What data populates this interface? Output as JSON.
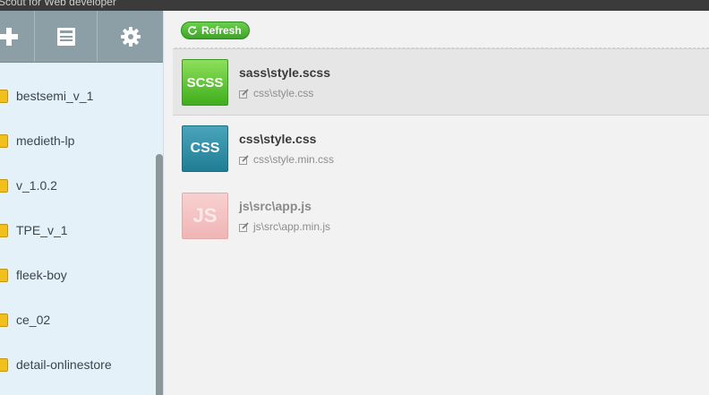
{
  "window": {
    "title": "Scout for Web developer"
  },
  "toolbar": {
    "add": {
      "icon": "plus-icon"
    },
    "log": {
      "icon": "document-icon"
    },
    "settings": {
      "icon": "gear-icon"
    }
  },
  "projects": [
    {
      "label": "bestsemi_v_1"
    },
    {
      "label": "medieth-lp"
    },
    {
      "label": "v_1.0.2"
    },
    {
      "label": "TPE_v_1"
    },
    {
      "label": "fleek-boy"
    },
    {
      "label": "ce_02"
    },
    {
      "label": "detail-onlinestore"
    }
  ],
  "main": {
    "refresh_label": "Refresh",
    "files": [
      {
        "badge": "SCSS",
        "name": "sass\\style.scss",
        "output": "css\\style.css",
        "color": "#4cbf27"
      },
      {
        "badge": "CSS",
        "name": "css\\style.css",
        "output": "css\\style.min.css",
        "color": "#2a8ea6"
      },
      {
        "badge": "JS",
        "name": "js\\src\\app.js",
        "output": "js\\src\\app.min.js",
        "color": "#f2bcbc"
      }
    ]
  }
}
